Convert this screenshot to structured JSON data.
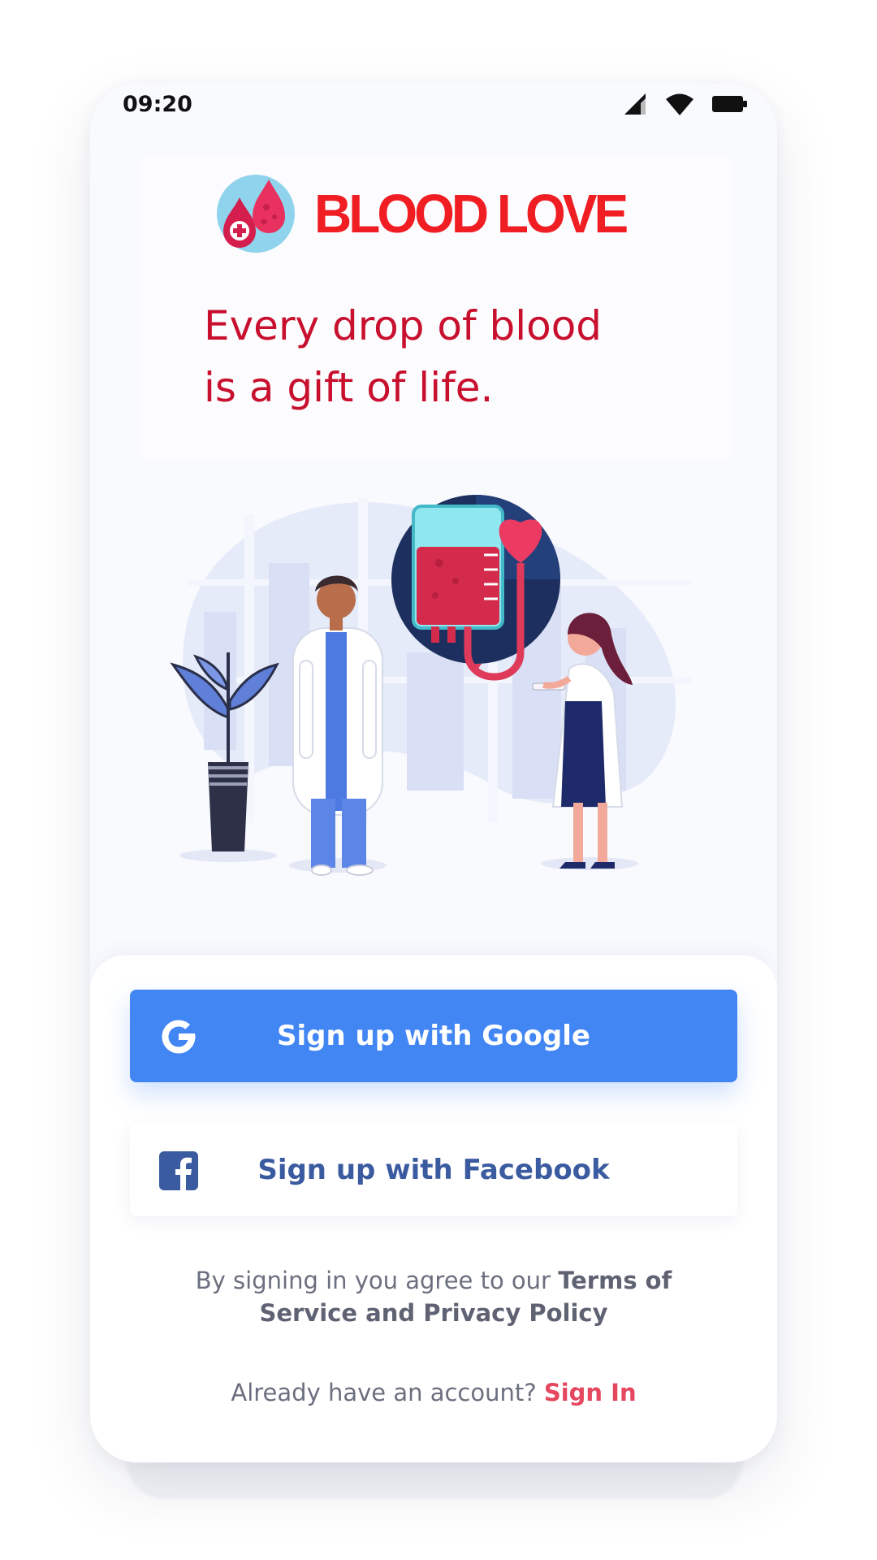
{
  "status_bar": {
    "time": "09:20",
    "icons": [
      "signal-icon",
      "wifi-icon",
      "battery-icon"
    ]
  },
  "header": {
    "brand_name": "BLOOD LOVE",
    "logo_icon": "blood-drops-logo-icon",
    "tagline_line1": "Every drop of blood",
    "tagline_line2": "is a gift of life."
  },
  "illustration": {
    "name": "doctors-blood-donation-illustration"
  },
  "auth": {
    "google_label": "Sign up with Google",
    "google_icon": "google-icon",
    "facebook_label": "Sign up with Facebook",
    "facebook_icon": "facebook-icon",
    "terms_prefix": "By signing in you agree to our ",
    "terms_bold": "Terms of Service and Privacy Policy",
    "account_prompt": "Already have an account?",
    "signin_label": "Sign In"
  },
  "colors": {
    "brand_red": "#f01e23",
    "tagline_red": "#c8102e",
    "google_blue": "#4286f4",
    "facebook_blue": "#3b5ba0",
    "signin_pink": "#e5475f"
  }
}
